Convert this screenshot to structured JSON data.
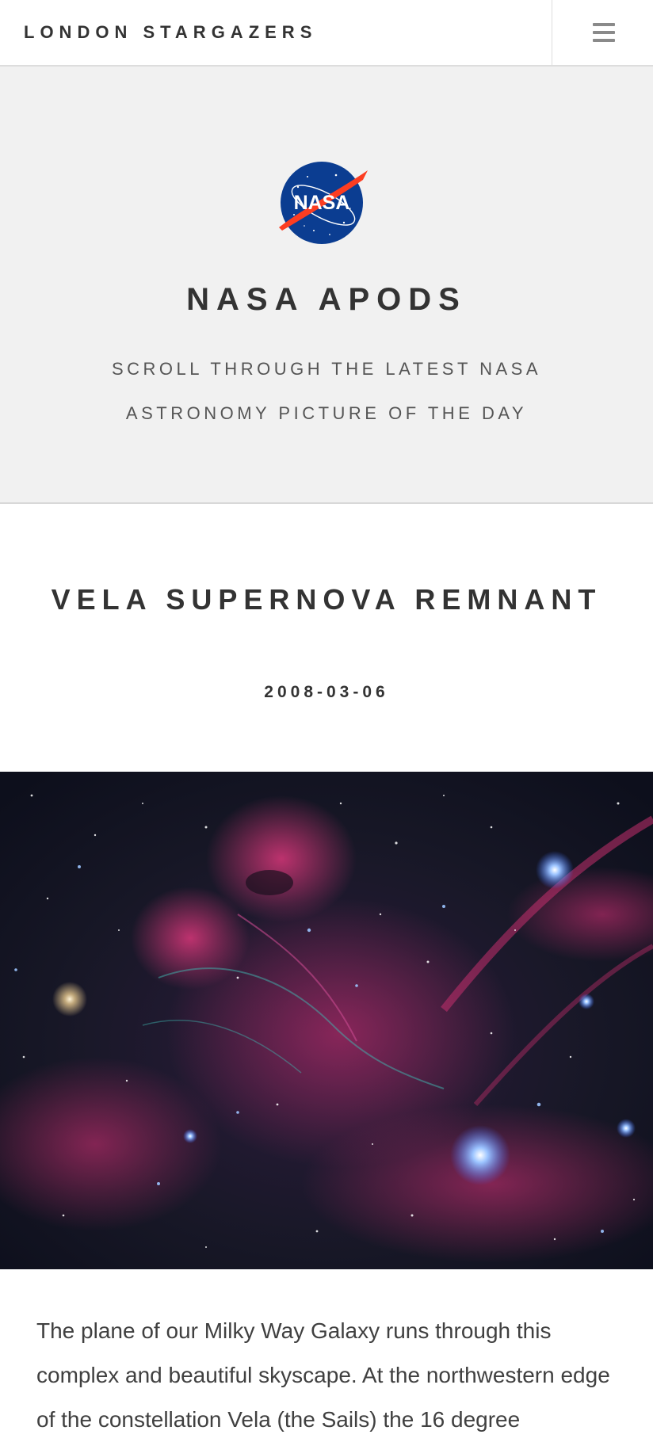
{
  "header": {
    "brand": "LONDON STARGAZERS",
    "menu_icon": "hamburger-menu-icon"
  },
  "hero": {
    "logo_icon": "nasa-logo",
    "logo_text": "NASA",
    "title": "NASA APODS",
    "subtitle": "SCROLL THROUGH THE LATEST NASA ASTRONOMY PICTURE OF THE DAY"
  },
  "post": {
    "title": "VELA SUPERNOVA REMNANT",
    "date": "2008-03-06",
    "image_icon": "space-nebula-image",
    "text": "The plane of our Milky Way Galaxy runs through this complex and beautiful skyscape. At the northwestern edge of the constellation Vela (the Sails) the 16 degree"
  },
  "colors": {
    "header_bg": "#ffffff",
    "hero_bg": "#f1f1f1",
    "text": "#333333",
    "nasa_blue": "#0b3d91",
    "nasa_red": "#fc3d21"
  }
}
